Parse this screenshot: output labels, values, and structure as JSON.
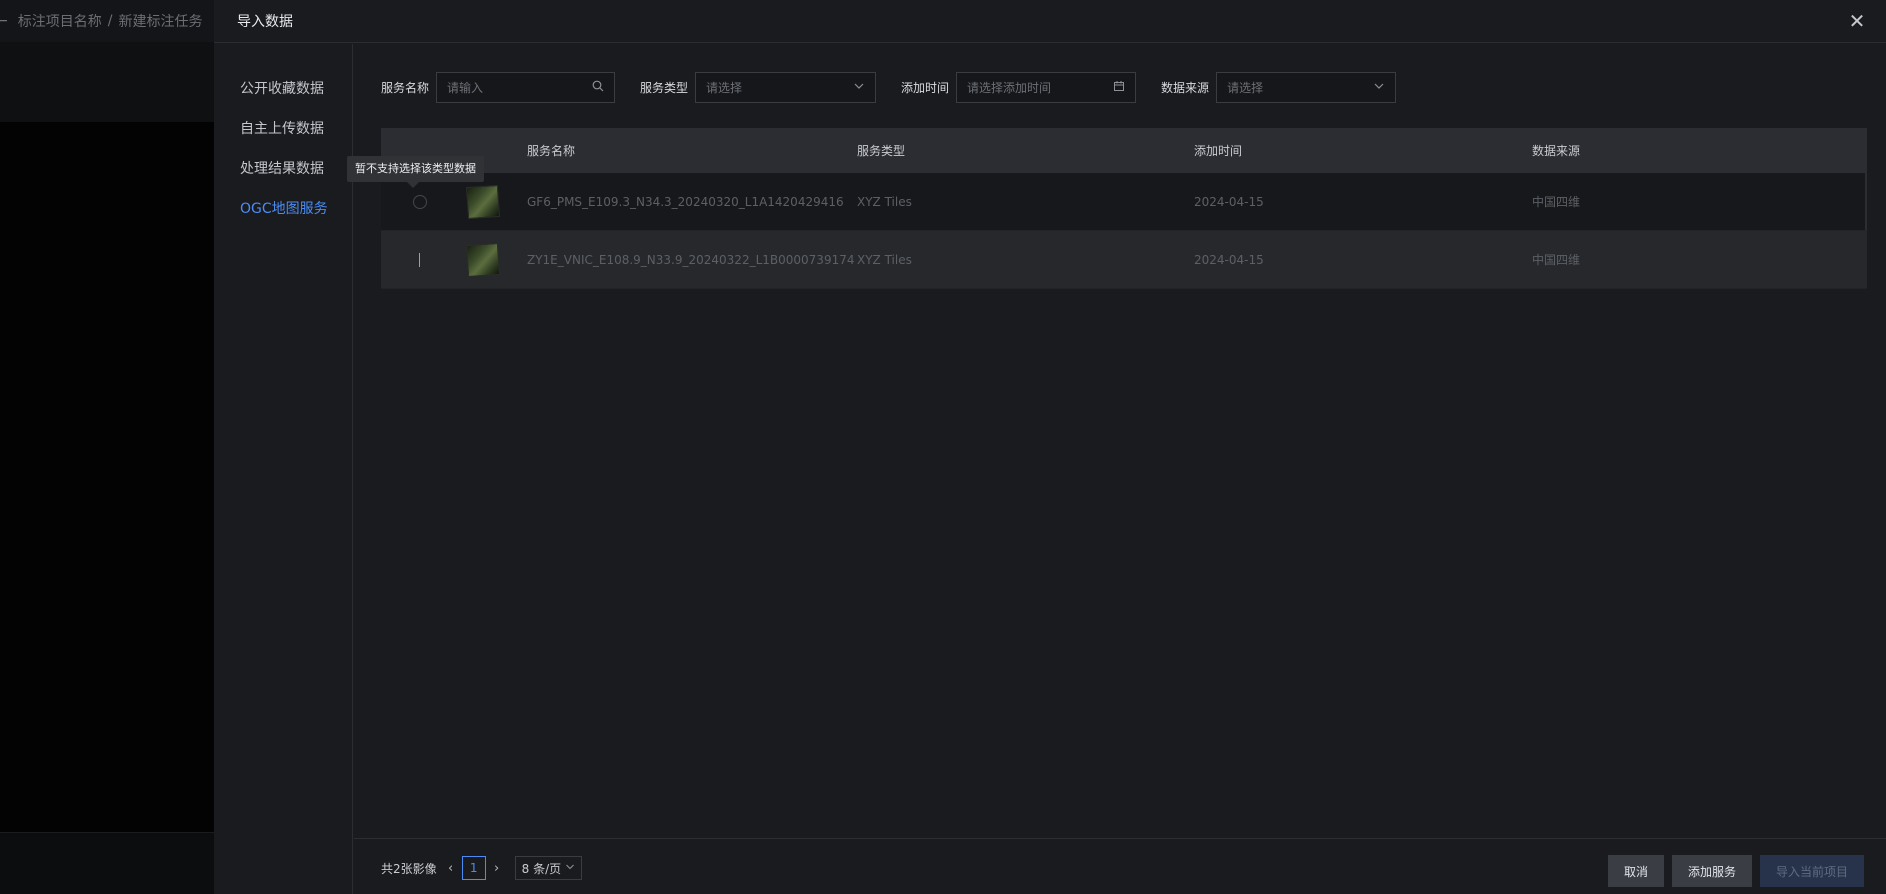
{
  "background": {
    "breadcrumb": [
      "标注项目名称",
      "新建标注任务"
    ],
    "separator": "/"
  },
  "drawer": {
    "title": "导入数据"
  },
  "side_menu": {
    "items": [
      {
        "label": "公开收藏数据",
        "active": false
      },
      {
        "label": "自主上传数据",
        "active": false
      },
      {
        "label": "处理结果数据",
        "active": false
      },
      {
        "label": "OGC地图服务",
        "active": true
      }
    ]
  },
  "filters": {
    "service_name": {
      "label": "服务名称",
      "placeholder": "请输入"
    },
    "service_type": {
      "label": "服务类型",
      "placeholder": "请选择"
    },
    "add_time": {
      "label": "添加时间",
      "placeholder": "请选择添加时间"
    },
    "data_source": {
      "label": "数据来源",
      "placeholder": "请选择"
    }
  },
  "table": {
    "columns": [
      "服务名称",
      "服务类型",
      "添加时间",
      "数据来源"
    ],
    "rows": [
      {
        "name": "GF6_PMS_E109.3_N34.3_20240320_L1A1420429416",
        "type": "XYZ Tiles",
        "time": "2024-04-15",
        "source": "中国四维"
      },
      {
        "name": "ZY1E_VNIC_E108.9_N33.9_20240322_L1B0000739174",
        "type": "XYZ Tiles",
        "time": "2024-04-15",
        "source": "中国四维"
      }
    ]
  },
  "tooltip": {
    "text": "暂不支持选择该类型数据"
  },
  "pagination": {
    "total": "共2张影像",
    "current_page": "1",
    "page_size": "8 条/页"
  },
  "actions": {
    "cancel": "取消",
    "add_service": "添加服务",
    "import_project": "导入当前项目"
  },
  "colors": {
    "accent": "#4a8cf5",
    "drawer_bg": "#1a1b1e",
    "table_header_bg": "#2b2d32"
  }
}
